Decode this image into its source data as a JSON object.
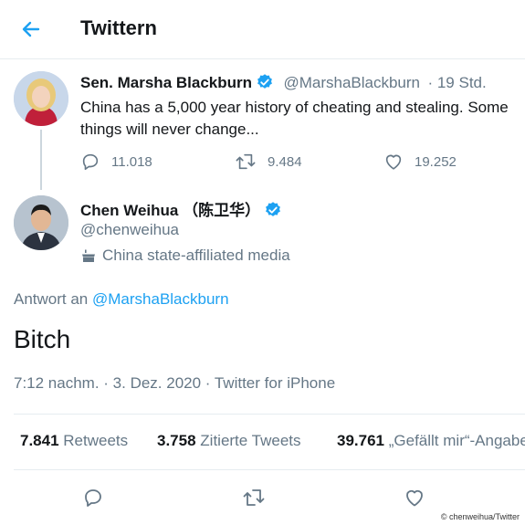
{
  "header": {
    "title": "Twittern"
  },
  "tweet1": {
    "author_name": "Sen. Marsha Blackburn",
    "handle": "@MarshaBlackburn",
    "time": "· 19 Std.",
    "text": "China has a 5,000 year history of cheating and stealing. Some things will never change...",
    "replies": "11.018",
    "retweets": "9.484",
    "likes": "19.252"
  },
  "tweet2": {
    "author_name": "Chen Weihua （陈卫华）",
    "handle": "@chenweihua",
    "affiliation": "China state-affiliated media",
    "reply_prefix": "Antwort an",
    "reply_mention": "@MarshaBlackburn",
    "text": "Bitch",
    "meta": "7:12 nachm. · 3. Dez. 2020 · Twitter for iPhone",
    "stats": {
      "retweets_count": "7.841",
      "retweets_label": "Retweets",
      "quotes_count": "3.758",
      "quotes_label": "Zitierte Tweets",
      "likes_count": "39.761",
      "likes_label": "„Gefällt mir“-Angaben"
    }
  },
  "credit": "© chenweihua/Twitter",
  "colors": {
    "accent": "#1da1f2",
    "muted": "#657786",
    "text": "#14171a"
  },
  "icons": [
    "back-arrow-icon",
    "verified-badge-icon",
    "reply-icon",
    "retweet-icon",
    "like-icon",
    "state-media-icon"
  ]
}
